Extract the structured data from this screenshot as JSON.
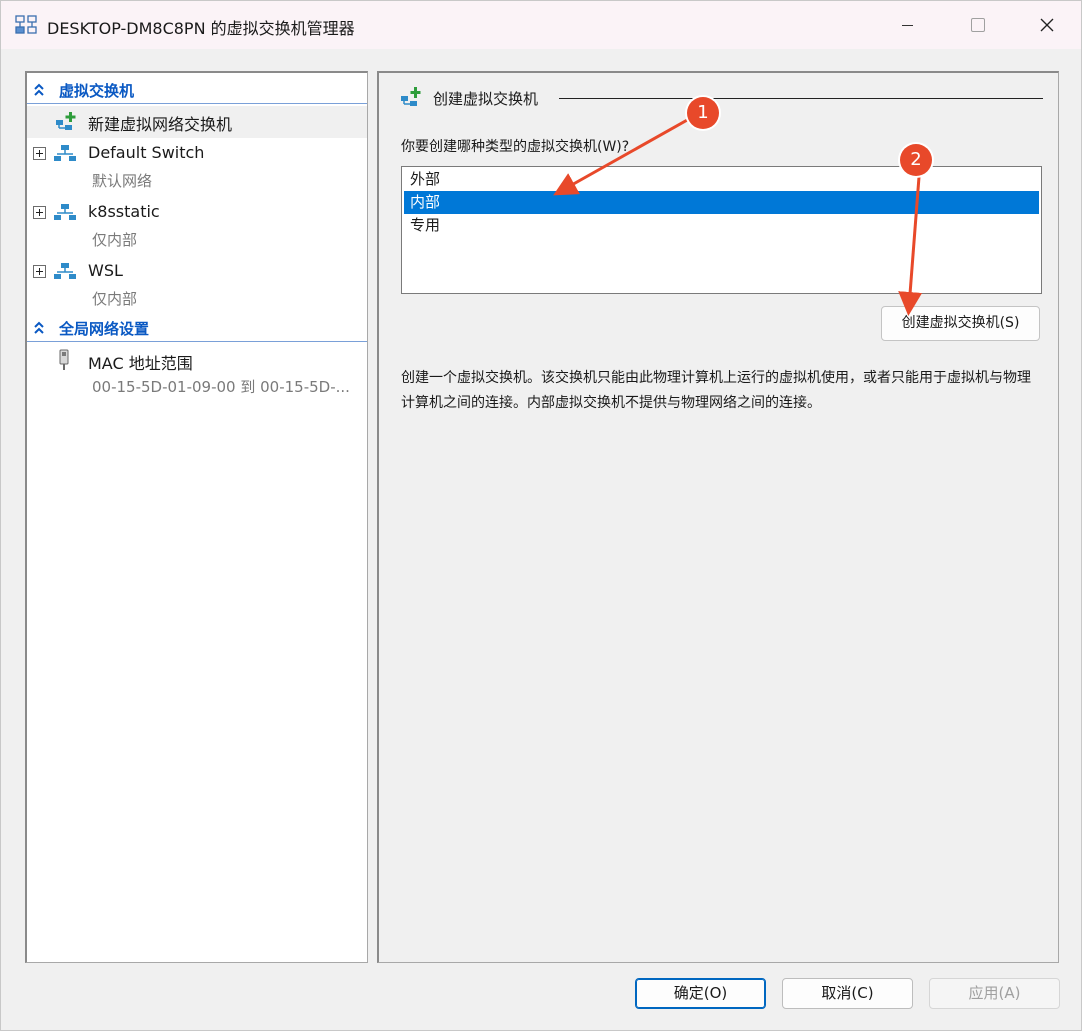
{
  "window": {
    "title": "DESKTOP-DM8C8PN 的虚拟交换机管理器"
  },
  "sidebar": {
    "section1": {
      "label": "虚拟交换机"
    },
    "new_switch": {
      "label": "新建虚拟网络交换机"
    },
    "switches": [
      {
        "name": "Default Switch",
        "type": "默认网络"
      },
      {
        "name": "k8sstatic",
        "type": "仅内部"
      },
      {
        "name": "WSL",
        "type": "仅内部"
      }
    ],
    "section2": {
      "label": "全局网络设置"
    },
    "mac": {
      "label": "MAC 地址范围",
      "value": "00-15-5D-01-09-00 到 00-15-5D-..."
    }
  },
  "main": {
    "group_title": "创建虚拟交换机",
    "question": "你要创建哪种类型的虚拟交换机(W)?",
    "options": [
      "外部",
      "内部",
      "专用"
    ],
    "selected_option": "内部",
    "create_button": "创建虚拟交换机(S)",
    "description": "创建一个虚拟交换机。该交换机只能由此物理计算机上运行的虚拟机使用，或者只能用于虚拟机与物理计算机之间的连接。内部虚拟交换机不提供与物理网络之间的连接。"
  },
  "buttons": {
    "ok": "确定(O)",
    "cancel": "取消(C)",
    "apply": "应用(A)"
  },
  "annotations": {
    "badge1": "1",
    "badge2": "2"
  },
  "colors": {
    "accent": "#0078d7",
    "section_header": "#0a59c3",
    "annotation": "#e8492a",
    "switch_icon": "#2e8bc9",
    "add_icon": "#2e9d3b"
  },
  "icons": {
    "title": "virtual-switch-manager-icon",
    "new_switch": "add-network-switch-icon",
    "switch": "network-switch-icon",
    "mac": "network-adapter-icon",
    "collapse": "double-chevron-up-icon"
  }
}
